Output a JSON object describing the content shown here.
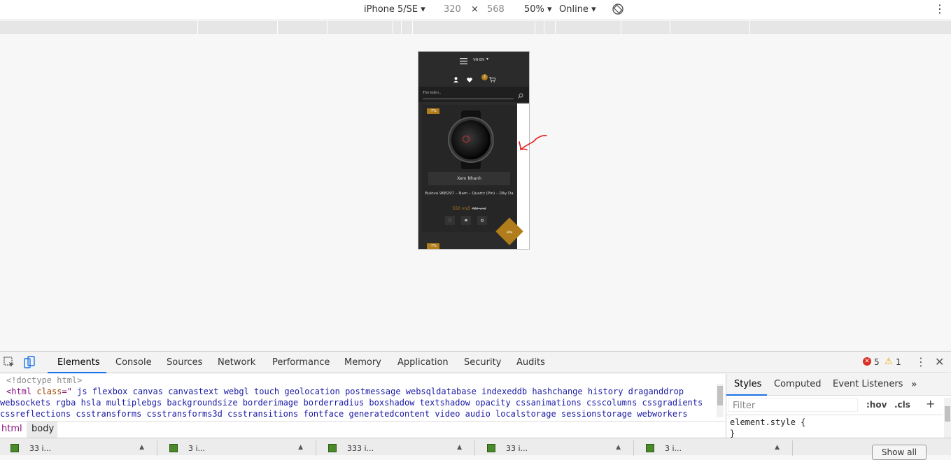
{
  "device_toolbar": {
    "device": "iPhone 5/SE",
    "width": "320",
    "times": "×",
    "height": "568",
    "zoom": "50%",
    "network": "Online"
  },
  "phone": {
    "lang": "VN-EN",
    "cart_count": "2",
    "search_placeholder": "Tìm kiếm..",
    "badge": "-7%",
    "quick_view": "Xem Nhanh",
    "product_name": "Bulova 96B297 – Nam – Quartz (Pin) – Dây Da",
    "price_new": "550 vnđ",
    "price_old": "780 vnđ",
    "badge2": "-7%"
  },
  "devtools": {
    "tabs": [
      "Elements",
      "Console",
      "Sources",
      "Network",
      "Performance",
      "Memory",
      "Application",
      "Security",
      "Audits"
    ],
    "errors": "5",
    "warnings": "1",
    "code": {
      "doctype": "<!doctype html>",
      "html_open": "<html",
      "class_attr": "class",
      "eq": "=\"",
      "line1": " js flexbox canvas canvastext webgl touch geolocation postmessage websqldatabase indexeddb hashchange history draganddrop",
      "line2": "websockets rgba hsla multiplebgs backgroundsize borderimage borderradius boxshadow textshadow opacity cssanimations csscolumns cssgradients",
      "line3": "cssreflections csstransforms csstransforms3d csstransitions fontface generatedcontent video audio localstorage sessionstorage webworkers"
    },
    "styles_tabs": [
      "Styles",
      "Computed",
      "Event Listeners"
    ],
    "filter_placeholder": "Filter",
    "hov": ":hov",
    "cls": ".cls",
    "element_style": "element.style {",
    "close_brace": "}",
    "crumbs": [
      "html",
      "body"
    ],
    "drawer": {
      "items": [
        "33 i...",
        "3 i...",
        "333 i...",
        "33 i...",
        "3 i..."
      ],
      "show_all": "Show all"
    }
  },
  "colors": {
    "accent": "#b07d1a",
    "devtools_blue": "#1a73e8",
    "annotation_red": "#e02020"
  }
}
